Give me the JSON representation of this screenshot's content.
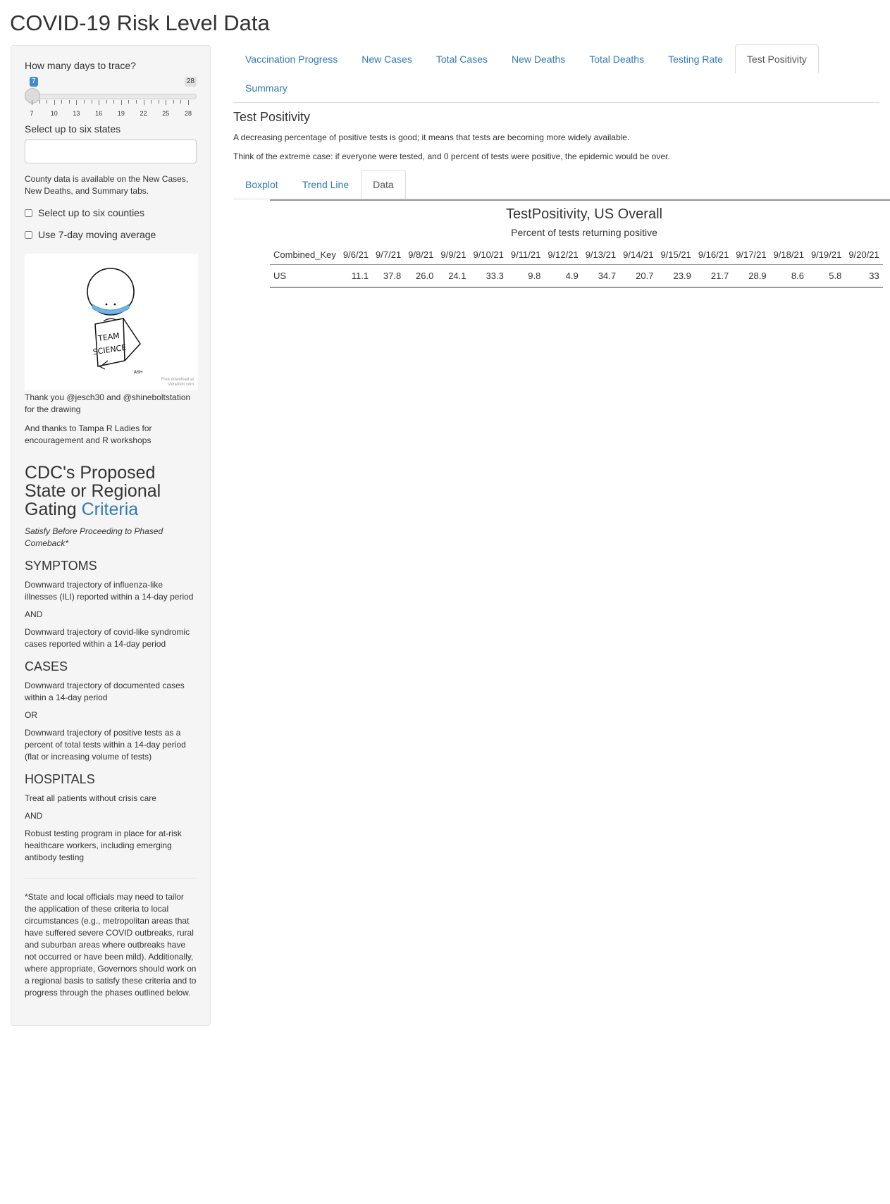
{
  "page": {
    "title": "COVID-19 Risk Level Data"
  },
  "sidebar": {
    "days_label": "How many days to trace?",
    "slider": {
      "min": 7,
      "max": 28,
      "value": 7,
      "min_badge": "7",
      "max_badge": "28",
      "labels": [
        "7",
        "10",
        "13",
        "16",
        "19",
        "22",
        "25",
        "28"
      ]
    },
    "states_label": "Select up to six states",
    "states_value": "",
    "county_note": "County data is available on the New Cases, New Deaths, and Summary tabs.",
    "counties_checkbox": {
      "label": "Select up to six counties",
      "checked": false
    },
    "moving_avg_checkbox": {
      "label": "Use 7-day moving average",
      "checked": false
    },
    "drawing": {
      "icon": "team-science-drawing",
      "text_line1": "TEAM",
      "text_line2": "SCIENCE",
      "signature": "ASH",
      "credit_line1": "Free download at",
      "credit_line2": "shinebolt.com"
    },
    "thanks_1": "Thank you @jesch30 and @shineboltstation for the drawing",
    "thanks_2": "And thanks to Tampa R Ladies for encouragement and R workshops",
    "cdc_heading": "CDC's Proposed State or Regional Gating",
    "cdc_link": "Criteria",
    "cdc_subtitle": "Satisfy Before Proceeding to Phased Comeback*",
    "symptoms": {
      "heading": "SYMPTOMS",
      "p1": "Downward trajectory of influenza-like illnesses (ILI) reported within a 14-day period",
      "join": "AND",
      "p2": "Downward trajectory of covid-like syndromic cases reported within a 14-day period"
    },
    "cases": {
      "heading": "CASES",
      "p1": "Downward trajectory of documented cases within a 14-day period",
      "join": "OR",
      "p2": "Downward trajectory of positive tests as a percent of total tests within a 14-day period (flat or increasing volume of tests)"
    },
    "hospitals": {
      "heading": "HOSPITALS",
      "p1": "Treat all patients without crisis care",
      "join": "AND",
      "p2": "Robust testing program in place for at-risk healthcare workers, including emerging antibody testing"
    },
    "footnote": "*State and local officials may need to tailor the application of these criteria to local circumstances (e.g., metropolitan areas that have suffered severe COVID outbreaks, rural and suburban areas where outbreaks have not occurred or have been mild). Additionally, where appropriate, Governors should work on a regional basis to satisfy these criteria and to progress through the phases outlined below."
  },
  "main": {
    "tabs": [
      "Vaccination Progress",
      "New Cases",
      "Total Cases",
      "New Deaths",
      "Total Deaths",
      "Testing Rate",
      "Test Positivity",
      "Summary"
    ],
    "active_tab": "Test Positivity",
    "section_title": "Test Positivity",
    "desc1": "A decreasing percentage of positive tests is good; it means that tests are becoming more widely available.",
    "desc2": "Think of the extreme case: if everyone were tested, and 0 percent of tests were positive, the epidemic would be over.",
    "subtabs": [
      "Boxplot",
      "Trend Line",
      "Data"
    ],
    "active_subtab": "Data",
    "table": {
      "title": "TestPositivity, US Overall",
      "subtitle": "Percent of tests returning positive",
      "columns": [
        "Combined_Key",
        "9/6/21",
        "9/7/21",
        "9/8/21",
        "9/9/21",
        "9/10/21",
        "9/11/21",
        "9/12/21",
        "9/13/21",
        "9/14/21",
        "9/15/21",
        "9/16/21",
        "9/17/21",
        "9/18/21",
        "9/19/21",
        "9/20/21"
      ],
      "rows": [
        [
          "US",
          "11.1",
          "37.8",
          "26.0",
          "24.1",
          "33.3",
          "9.8",
          "4.9",
          "34.7",
          "20.7",
          "23.9",
          "21.7",
          "28.9",
          "8.6",
          "5.8",
          "33"
        ]
      ]
    }
  }
}
